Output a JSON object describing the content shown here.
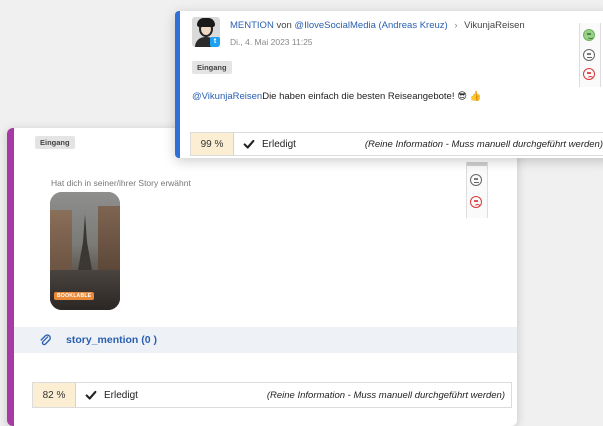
{
  "front_card": {
    "type_label": "MENTION",
    "von": "von",
    "author": "@IloveSocialMedia (Andreas Kreuz)",
    "arrow": "›",
    "target": "VikunjaReisen",
    "date": "Di., 4. Mai 2023 11:25",
    "badge": "Eingang",
    "mention": "@VikunjaReisen",
    "message": "Die haben einfach die besten Reiseangebote! 😎 👍",
    "status": {
      "percent": "99 %",
      "done_label": "Erledigt",
      "info": "(Reine Information - Muss manuell durchgeführt werden)"
    }
  },
  "back_card": {
    "badge": "Eingang",
    "story_label": "Hat dich in seiner/ihrer Story erwähnt",
    "thumb_tag": "BOOKLABLE",
    "attachment_link": "story_mention (0 )",
    "status": {
      "percent": "82 %",
      "done_label": "Erledigt",
      "info": "(Reine Information - Muss manuell durchgeführt werden)"
    }
  },
  "colors": {
    "front_accent": "#2f6fd6",
    "back_accent": "#a83aa6",
    "link": "#2a5fb0",
    "percent_bg": "#fbeed3",
    "sad_red": "#d9383a",
    "happy_green": "#9ad08a"
  },
  "icons": {
    "reaction_positive": "happy-face-icon",
    "reaction_neutral": "neutral-face-icon",
    "reaction_negative": "sad-face-icon",
    "attachment": "paperclip-icon",
    "done": "checkmark-icon",
    "platform": "twitter-icon"
  }
}
